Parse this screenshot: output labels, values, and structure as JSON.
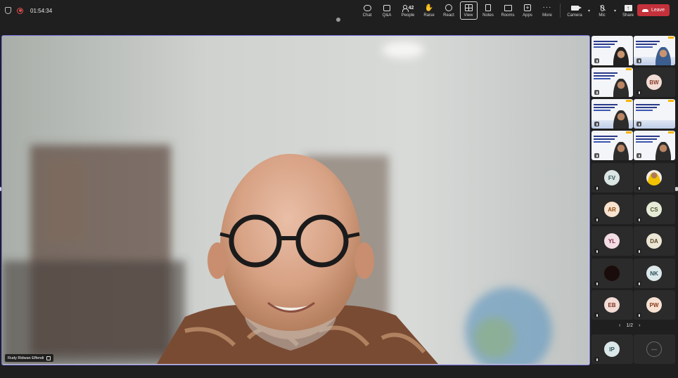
{
  "meeting": {
    "timer": "01:54:34",
    "leave_label": "Leave"
  },
  "toolbar": {
    "chat": "Chat",
    "qa": "Q&A",
    "people": "People",
    "people_count": "42",
    "raise": "Raise",
    "react": "React",
    "view": "View",
    "notes": "Notes",
    "rooms": "Rooms",
    "apps": "Apps",
    "more": "More",
    "camera": "Camera",
    "mic": "Mic",
    "share": "Share",
    "active_tool": "View"
  },
  "main_video": {
    "speaker_name": "Rudy Ridwan Effendi"
  },
  "gallery": {
    "page_label": "1/2",
    "avatars": [
      {
        "initials": "BW",
        "bg": "#f1ddd5",
        "fg": "#8a3c2a"
      },
      {
        "initials": "FV",
        "bg": "#dbe5e4",
        "fg": "#2f5150"
      },
      {
        "initials": "AR",
        "bg": "#f7e3cf",
        "fg": "#8a4a10"
      },
      {
        "initials": "CS",
        "bg": "#e6ebd8",
        "fg": "#4a5a2a"
      },
      {
        "initials": "YL",
        "bg": "#f3dde4",
        "fg": "#7a2a40"
      },
      {
        "initials": "DA",
        "bg": "#ece6d6",
        "fg": "#5a4a25"
      },
      {
        "initials": "NK",
        "bg": "#dde8ea",
        "fg": "#2a5058"
      },
      {
        "initials": "EB",
        "bg": "#f3dcd5",
        "fg": "#7a3020"
      },
      {
        "initials": "PW",
        "bg": "#f7e1d3",
        "fg": "#8a3a1a"
      },
      {
        "initials": "IP",
        "bg": "#dbe7e8",
        "fg": "#2a4f55"
      }
    ]
  },
  "colors": {
    "accent_border": "#7b74e0",
    "leave": "#c4313b",
    "background": "#1f1f1f"
  }
}
